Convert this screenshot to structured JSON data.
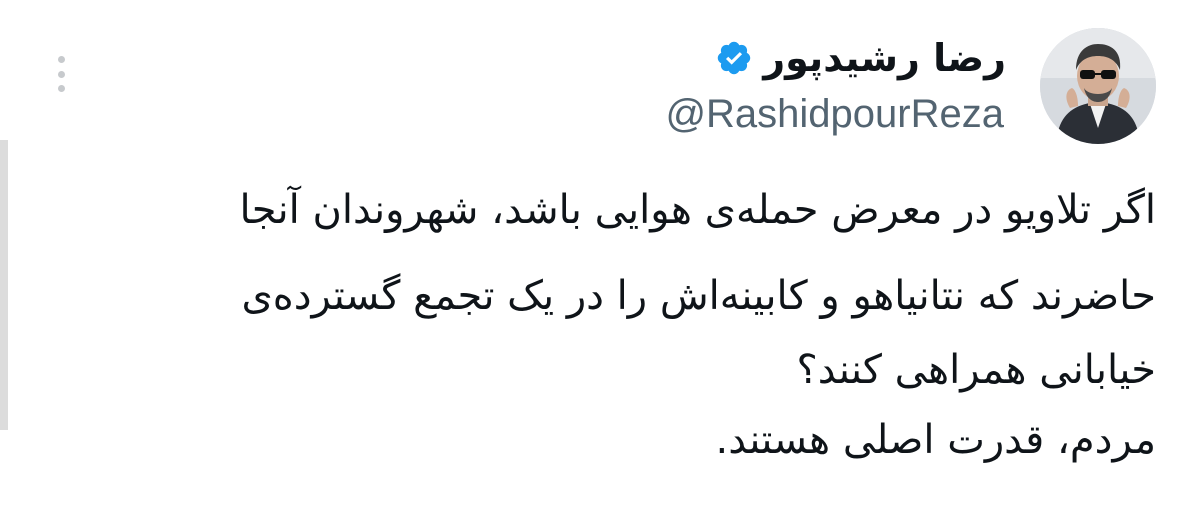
{
  "author": {
    "display_name": "رضا رشیدپور",
    "handle": "@RashidpourReza",
    "verified": true,
    "verified_badge_color": "#1d9bf0"
  },
  "icons": {
    "more": "more-vertical-icon",
    "verified": "verified-badge-icon",
    "avatar": "profile-avatar"
  },
  "tweet": {
    "lines": [
      "اگر تلاویو در معرض حمله‌ی هوایی باشد، شهروندان آنجا",
      "حاضرند که نتانیاهو و کابینه‌اش را در یک تجمع گسترده‌ی",
      "خیابانی همراهی کنند؟",
      "مردم، قدرت اصلی هستند."
    ]
  },
  "colors": {
    "text": "#0f1419",
    "secondary_text": "#536471",
    "more_dots": "#c7cacd",
    "background": "#ffffff"
  }
}
